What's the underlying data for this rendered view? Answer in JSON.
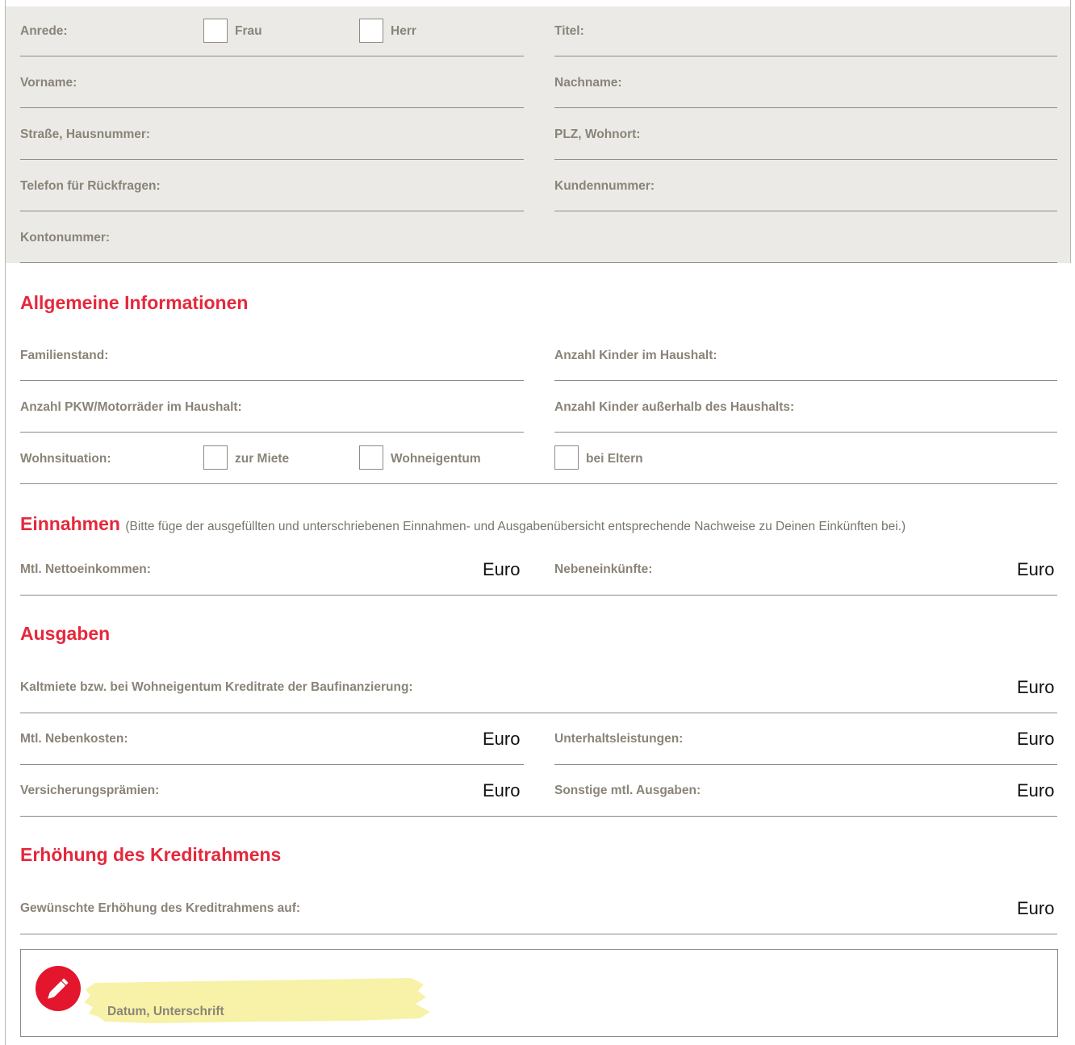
{
  "personal": {
    "anrede": "Anrede:",
    "frau": "Frau",
    "herr": "Herr",
    "titel": "Titel:",
    "vorname": "Vorname:",
    "nachname": "Nachname:",
    "strasse": "Straße, Hausnummer:",
    "plz": "PLZ, Wohnort:",
    "telefon": "Telefon für Rückfragen:",
    "kundennummer": "Kundennummer:",
    "kontonummer": "Kontonummer:"
  },
  "allgemein": {
    "heading": "Allgemeine Informationen",
    "familienstand": "Familienstand:",
    "kinder_im_haushalt": "Anzahl Kinder im Haushalt:",
    "pkw": "Anzahl PKW/Motorräder im Haushalt:",
    "kinder_ausserhalb": "Anzahl Kinder außerhalb des Haushalts:",
    "wohnsituation": "Wohnsituation:",
    "miete": "zur Miete",
    "eigentum": "Wohneigentum",
    "eltern": "bei Eltern"
  },
  "einnahmen": {
    "heading": "Einnahmen",
    "note": "(Bitte füge der ausgefüllten und unterschriebenen Einnahmen- und Ausgabenübersicht entsprechende Nachweise zu Deinen Einkünften bei.)",
    "netto": "Mtl. Nettoeinkommen:",
    "neben": "Nebeneinkünfte:"
  },
  "ausgaben": {
    "heading": "Ausgaben",
    "kaltmiete": "Kaltmiete bzw. bei Wohneigentum Kreditrate der Baufinanzierung:",
    "nebenkosten": "Mtl. Nebenkosten:",
    "unterhalt": "Unterhaltsleistungen:",
    "versicherung": "Versicherungsprämien:",
    "sonstige": "Sonstige mtl. Ausgaben:"
  },
  "kredit": {
    "heading": "Erhöhung des Kreditrahmens",
    "wunsch": "Gewünschte Erhöhung des Kreditrahmens auf:"
  },
  "currency": "Euro",
  "signature": {
    "label": "Datum, Unterschrift",
    "icon": "pencil-icon"
  },
  "colors": {
    "accent": "#e5283c",
    "label": "#8a8478",
    "panel": "#ebeae6",
    "highlight": "#f7f2a8"
  }
}
